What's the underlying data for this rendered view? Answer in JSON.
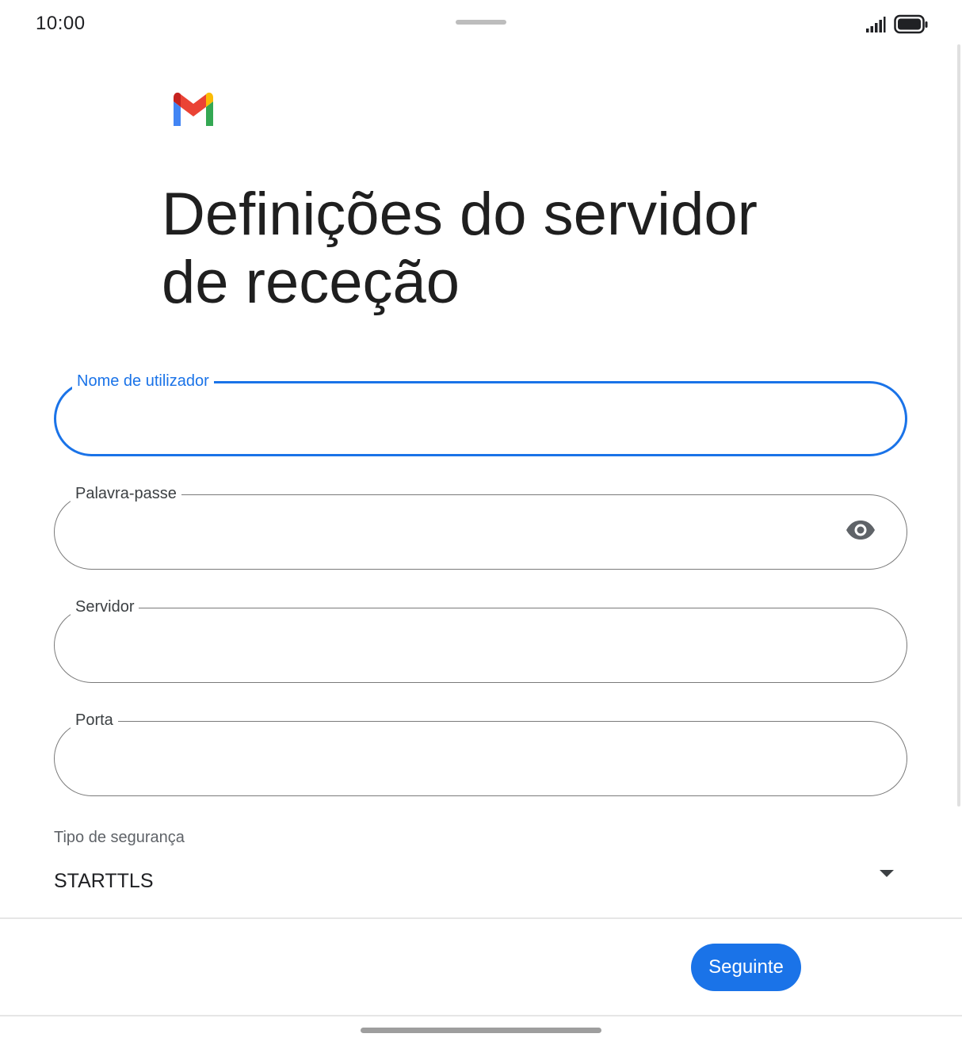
{
  "status_bar": {
    "time": "10:00",
    "signal_icon": "signal-icon",
    "battery_icon": "battery-icon"
  },
  "logo": {
    "icon": "gmail-logo-icon",
    "colors": [
      "#4285F4",
      "#EA4335",
      "#FBBC04",
      "#34A853",
      "#C5221F"
    ]
  },
  "title": {
    "line1": "Definições do servidor",
    "line2": "de receção"
  },
  "form": {
    "username": {
      "label": "Nome de utilizador",
      "value": ""
    },
    "password": {
      "label": "Palavra-passe",
      "value": "",
      "toggle_icon": "eye-icon"
    },
    "server": {
      "label": "Servidor",
      "value": ""
    },
    "port": {
      "label": "Porta",
      "value": ""
    },
    "security": {
      "label": "Tipo de segurança",
      "selected": "STARTTLS"
    }
  },
  "footer": {
    "next_label": "Seguinte"
  },
  "colors": {
    "accent": "#1a73e8",
    "outline": "#7a7a7a"
  }
}
